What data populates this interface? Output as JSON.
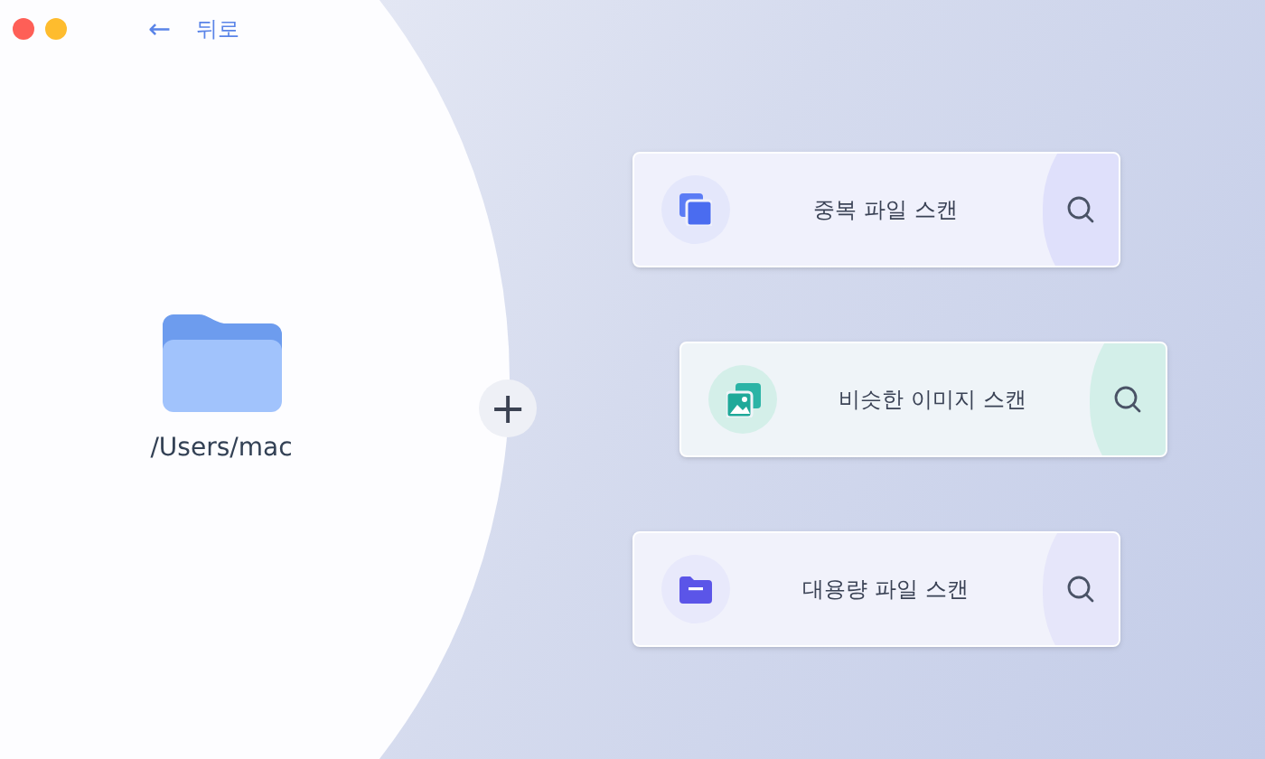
{
  "toolbar": {
    "back_icon": "←",
    "back_label": "뒤로"
  },
  "source": {
    "path": "/Users/mac",
    "add_icon": "+"
  },
  "scans": [
    {
      "kind": "duplicate",
      "label": "중복 파일 스캔"
    },
    {
      "kind": "image",
      "label": "비슷한 이미지 스캔"
    },
    {
      "kind": "large",
      "label": "대용량 파일 스캔"
    }
  ]
}
